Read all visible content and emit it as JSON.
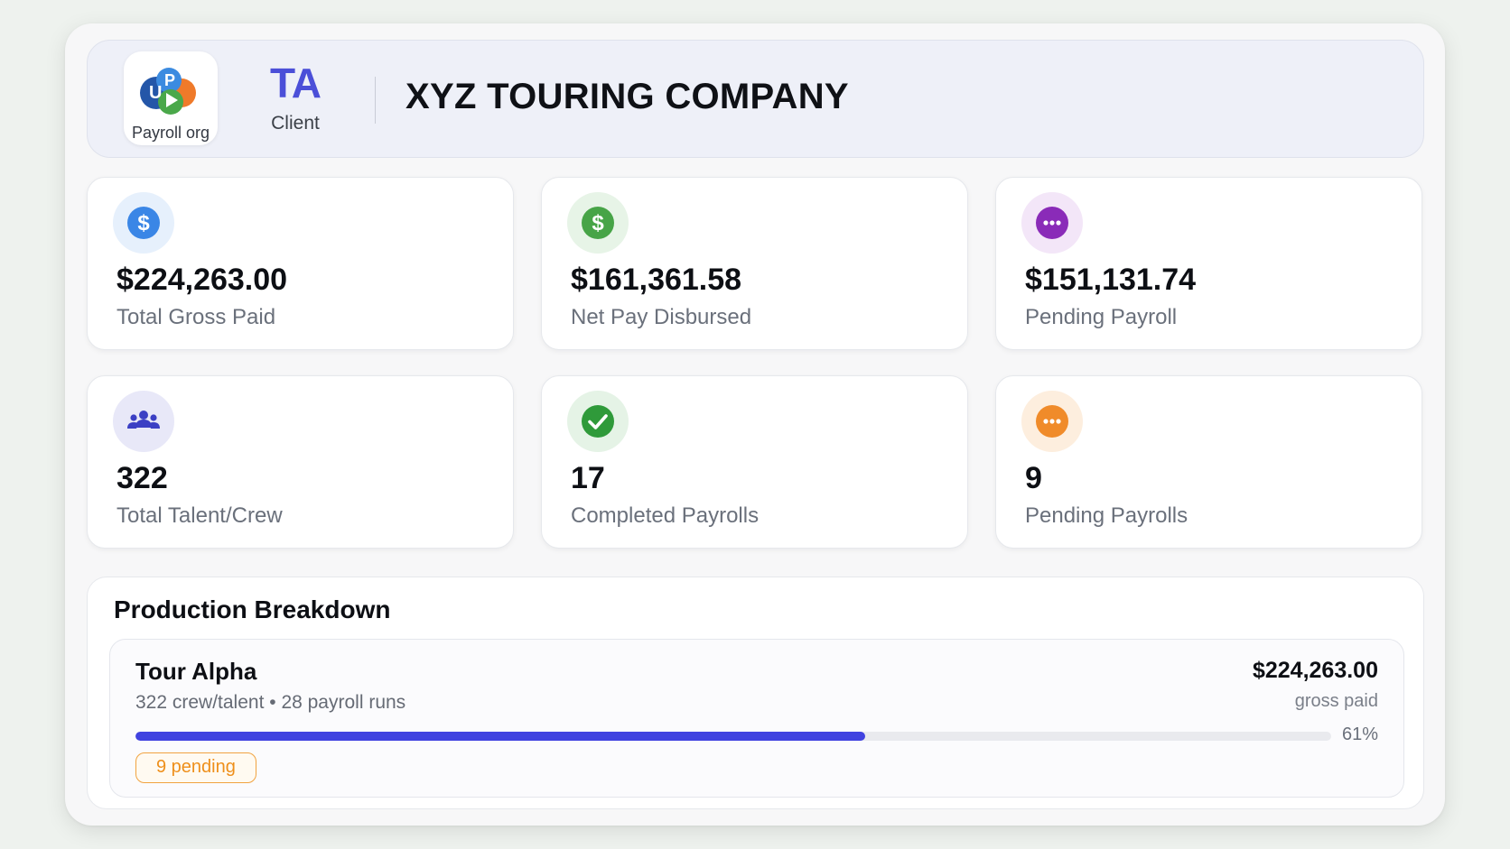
{
  "header": {
    "logo_caption": "Payroll org",
    "client_initials": "TA",
    "client_role": "Client",
    "company_name": "XYZ TOURING COMPANY"
  },
  "stats": [
    {
      "value": "$224,263.00",
      "label": "Total Gross Paid",
      "icon": "dollar-icon",
      "color": "#3a86e6",
      "bg": "#e6f0fc"
    },
    {
      "value": "$161,361.58",
      "label": "Net Pay Disbursed",
      "icon": "dollar-icon",
      "color": "#47a447",
      "bg": "#e7f4e7"
    },
    {
      "value": "$151,131.74",
      "label": "Pending Payroll",
      "icon": "ellipsis-icon",
      "color": "#8a2bb8",
      "bg": "#f3e6f8"
    },
    {
      "value": "322",
      "label": "Total Talent/Crew",
      "icon": "people-icon",
      "color": "#3b3fc4",
      "bg": "#e8e8f8"
    },
    {
      "value": "17",
      "label": "Completed Payrolls",
      "icon": "check-icon",
      "color": "#2f9a3a",
      "bg": "#e5f3e6"
    },
    {
      "value": "9",
      "label": "Pending Payrolls",
      "icon": "ellipsis-icon",
      "color": "#f08b2a",
      "bg": "#fdeede"
    }
  ],
  "breakdown": {
    "title": "Production Breakdown",
    "productions": [
      {
        "name": "Tour Alpha",
        "meta": "322 crew/talent • 28 payroll runs",
        "amount": "$224,263.00",
        "amount_label": "gross paid",
        "progress_percent": 61,
        "progress_label": "61%",
        "pending_badge": "9 pending",
        "accent": "#4143e0"
      }
    ]
  }
}
